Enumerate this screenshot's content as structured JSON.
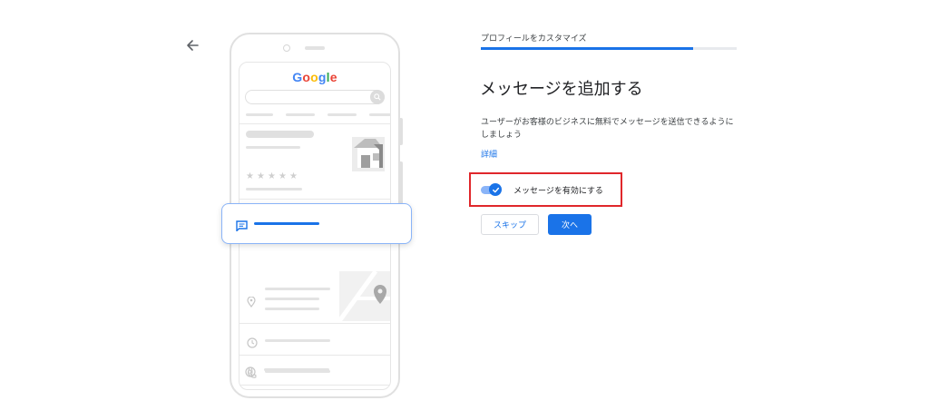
{
  "nav": {
    "back_icon": "arrow-left-icon"
  },
  "illustration": {
    "logo_text": "Google",
    "logo_colors": [
      "#4285f4",
      "#ea4335",
      "#fbbc05",
      "#4285f4",
      "#34a853",
      "#ea4335"
    ],
    "star_glyph": "★",
    "message_card_icon": "chat-icon",
    "action_icons": [
      "phone-icon",
      "directions-icon",
      "bookmark-icon",
      "website-icon"
    ],
    "row_icons": [
      "location-icon",
      "clock-icon",
      "phone-icon",
      "globe-icon"
    ]
  },
  "header": {
    "step_title": "プロフィールをカスタマイズ",
    "progress": 0.83
  },
  "main": {
    "title": "メッセージを追加する",
    "description": "ユーザーがお客様のビジネスに無料でメッセージを送信できるようにしましょう",
    "details_link": "詳細",
    "toggle": {
      "label": "メッセージを有効にする",
      "checked": true
    }
  },
  "buttons": {
    "skip": "スキップ",
    "next": "次へ"
  },
  "colors": {
    "accent": "#1a73e8",
    "highlight": "#e0272b",
    "toggle_track": "#8ab4f8"
  }
}
